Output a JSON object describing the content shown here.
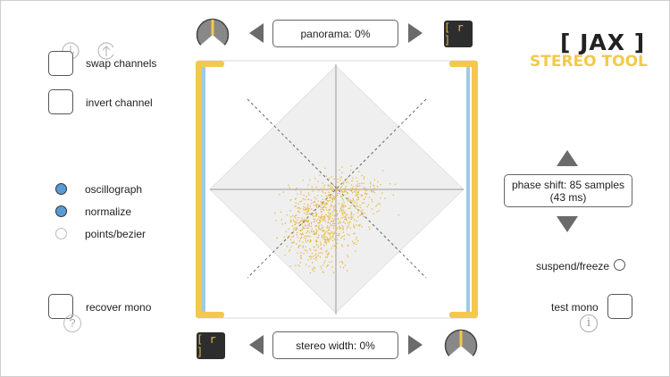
{
  "logo": {
    "title": "[ JAX ]",
    "subtitle": "STEREO TOOL"
  },
  "top_bar": {
    "panorama_label": "panorama: 0%",
    "reset_label": "[ r ]"
  },
  "bottom_bar": {
    "stereo_width_label": "stereo width: 0%",
    "reset_label": "[ r ]"
  },
  "left_panel": {
    "swap_channels": "swap channels",
    "invert_channel": "invert channel",
    "oscillograph": "oscillograph",
    "normalize": "normalize",
    "points_bezier": "points/bezier",
    "recover_mono": "recover mono",
    "help_glyph": "?"
  },
  "right_panel": {
    "phase_shift_line1": "phase shift: 85 samples",
    "phase_shift_line2": "(43 ms)",
    "suspend_freeze": "suspend/freeze",
    "test_mono": "test mono",
    "info_glyph": "i"
  },
  "states": {
    "oscillograph": true,
    "normalize": true,
    "points_bezier": false,
    "suspend_freeze": false
  },
  "colors": {
    "accent_yellow": "#f2c94c",
    "meter_blue": "#9ecbe6",
    "radio_blue": "#5b9bd5",
    "scatter": "#e8b947",
    "dark_button": "#2d2d2d"
  }
}
